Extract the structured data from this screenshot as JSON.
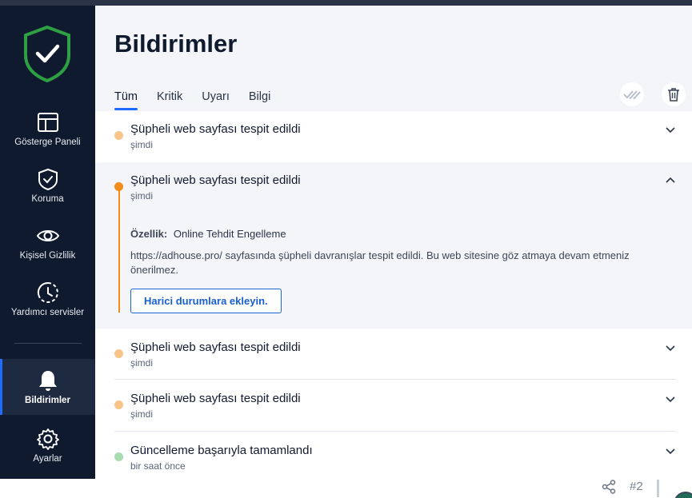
{
  "sidebar": {
    "items": [
      {
        "label": "Gösterge Paneli",
        "icon": "dashboard-icon"
      },
      {
        "label": "Koruma",
        "icon": "shield-check-icon"
      },
      {
        "label": "Kişisel Gizlilik",
        "icon": "eye-icon"
      },
      {
        "label": "Yardımcı servisler",
        "icon": "clock-services-icon"
      },
      {
        "label": "Bildirimler",
        "icon": "bell-icon",
        "active": true
      },
      {
        "label": "Ayarlar",
        "icon": "gear-icon"
      }
    ]
  },
  "header": {
    "title": "Bildirimler",
    "tabs": [
      "Tüm",
      "Kritik",
      "Uyarı",
      "Bilgi"
    ],
    "active_tab": "Tüm"
  },
  "notifications": [
    {
      "title": "Şüpheli web sayfası tespit edildi",
      "time": "şimdi",
      "severity_color": "#f7c48a",
      "expanded": false
    },
    {
      "title": "Şüpheli web sayfası tespit edildi",
      "time": "şimdi",
      "severity_color": "#f28c1a",
      "expanded": true,
      "detail_label": "Özellik:",
      "detail_value": "Online Tehdit Engelleme",
      "detail_text": "https://adhouse.pro/ sayfasında şüpheli davranışlar tespit edildi. Bu web sitesine göz atmaya devam etmeniz önerilmez.",
      "action_label": "Harici durumlara ekleyin."
    },
    {
      "title": "Şüpheli web sayfası tespit edildi",
      "time": "şimdi",
      "severity_color": "#f7c48a",
      "expanded": false
    },
    {
      "title": "Şüpheli web sayfası tespit edildi",
      "time": "şimdi",
      "severity_color": "#f7c48a",
      "expanded": false
    },
    {
      "title": "Güncelleme başarıyla tamamlandı",
      "time": "bir saat önce",
      "severity_color": "#a8dcae",
      "expanded": false
    }
  ],
  "footer": {
    "page_id": "#2"
  },
  "colors": {
    "sidebar_bg": "#0f1a2e",
    "accent": "#1f6bff",
    "shield_green": "#2ea043"
  }
}
